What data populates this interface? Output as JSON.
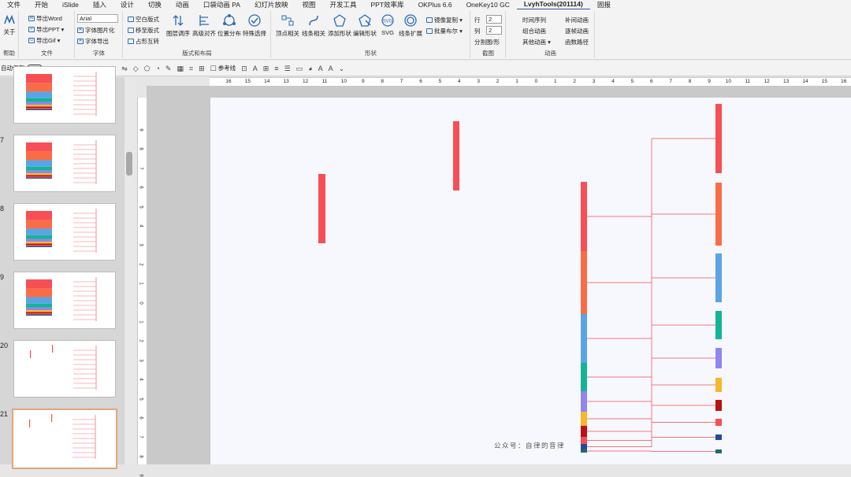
{
  "menu": [
    "文件",
    "开始",
    "iSlide",
    "插入",
    "设计",
    "切换",
    "动画",
    "口袋动画 PA",
    "幻灯片放映",
    "视图",
    "开发工具",
    "PPT效率库",
    "OKPlus 6.6",
    "OneKey10 GC",
    "LvyhTools(201114)",
    "固报"
  ],
  "ribbon": {
    "help": {
      "btn": "关于",
      "label": "帮助"
    },
    "file": {
      "word": "导出Word",
      "ppt": "导出PPT ▾",
      "gif": "导出Gif ▾",
      "label": "文件"
    },
    "font": {
      "name": "Arial",
      "pic": "字体图片化",
      "export": "字体导出",
      "label": "字体"
    },
    "layout": {
      "b1": "空白版式",
      "b2": "移至版式",
      "b3": "占形互转",
      "big1": "图层调序",
      "big2": "高级对齐",
      "big3": "位置分布",
      "big4": "特殊选择",
      "label": "版式和布局"
    },
    "shape": {
      "big1": "顶点相关",
      "big2": "线条相关",
      "big3": "添加形状",
      "big4": "编辑形状",
      "big5": "SVG",
      "big6": "线条扩展",
      "s1": "镜像复制 ▾",
      "s2": "批量布尔 ▾",
      "label": "形状"
    },
    "split": {
      "row": "行",
      "col": "列",
      "row_val": "2",
      "col_val": "2",
      "btn": "分割图/形",
      "label": "截图"
    },
    "anim": {
      "a1": "时间序列",
      "a2": "组合动画",
      "a3": "其他动画 ▾",
      "a4": "补间动画",
      "a5": "逐帧动画",
      "a6": "函数路径",
      "label": "动画"
    }
  },
  "qat": {
    "autosave": "自动保存",
    "ref": "参考线"
  },
  "slides": [
    {
      "num": "",
      "type": "stack"
    },
    {
      "num": "7",
      "type": "stack"
    },
    {
      "num": "8",
      "type": "stack"
    },
    {
      "num": "9",
      "type": "stack"
    },
    {
      "num": "20",
      "type": "lines"
    },
    {
      "num": "21",
      "type": "lines",
      "selected": true
    }
  ],
  "ruler_h": [
    "16",
    "15",
    "14",
    "13",
    "12",
    "11",
    "10",
    "9",
    "8",
    "7",
    "6",
    "5",
    "4",
    "3",
    "2",
    "1",
    "0",
    "1",
    "2",
    "3",
    "4",
    "5",
    "6",
    "7",
    "8",
    "9",
    "10",
    "11",
    "12",
    "13",
    "14",
    "15",
    "16"
  ],
  "ruler_v": [
    "9",
    "8",
    "7",
    "6",
    "5",
    "4",
    "3",
    "2",
    "1",
    "0",
    "1",
    "2",
    "3",
    "4",
    "5",
    "6",
    "7",
    "8",
    "9"
  ],
  "watermark": "公众号：自律的音律",
  "colors": {
    "red": "#f74f55",
    "orange": "#f96d46",
    "blue": "#5aa4e6",
    "teal": "#14b496",
    "purple": "#9285ef",
    "yellow": "#f6b72b",
    "darkred": "#b81212",
    "navy": "#204d98",
    "darkteal": "#256a6a",
    "line": "#f0777b"
  },
  "chart": {
    "stack_segments": [
      {
        "color": "red",
        "value": 88
      },
      {
        "color": "orange",
        "value": 80
      },
      {
        "color": "blue",
        "value": 62
      },
      {
        "color": "teal",
        "value": 36
      },
      {
        "color": "purple",
        "value": 26
      },
      {
        "color": "yellow",
        "value": 18
      },
      {
        "color": "darkred",
        "value": 14
      },
      {
        "color": "red",
        "value": 9
      },
      {
        "color": "navy",
        "value": 7
      },
      {
        "color": "darkteal",
        "value": 4
      }
    ],
    "right_bars": [
      {
        "color": "red",
        "value": 88
      },
      {
        "color": "orange",
        "value": 80
      },
      {
        "color": "blue",
        "value": 62
      },
      {
        "color": "teal",
        "value": 36
      },
      {
        "color": "purple",
        "value": 26
      },
      {
        "color": "yellow",
        "value": 18
      },
      {
        "color": "darkred",
        "value": 14
      },
      {
        "color": "red",
        "value": 9
      },
      {
        "color": "navy",
        "value": 7
      },
      {
        "color": "darkteal",
        "value": 4
      }
    ],
    "loose_bars": [
      {
        "color": "red",
        "value": 88
      },
      {
        "color": "red",
        "value": 88
      }
    ]
  }
}
